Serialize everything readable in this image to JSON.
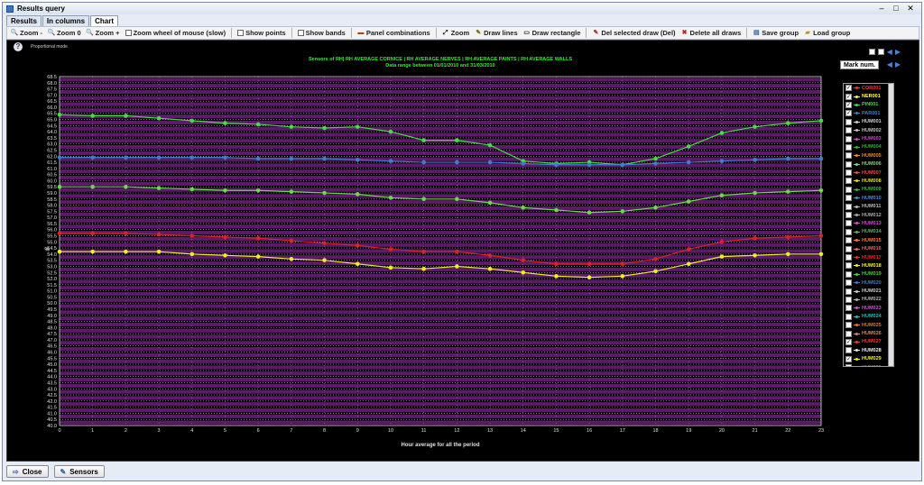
{
  "window": {
    "title": "Results query",
    "controls": {
      "minimize": "–",
      "maximize": "□",
      "close": "✕"
    }
  },
  "tabs": [
    {
      "label": "Results",
      "active": false
    },
    {
      "label": "In columns",
      "active": false
    },
    {
      "label": "Chart",
      "active": true
    }
  ],
  "toolbar": {
    "zoom_out": "Zoom -",
    "zoom_zero": "Zoom 0",
    "zoom_in": "Zoom +",
    "zoom_wheel": "Zoom wheel of mouse (slow)",
    "show_points": "Show points",
    "show_bands": "Show bands",
    "panel_combinations": "Panel combinations",
    "zoom": "Zoom",
    "draw_lines": "Draw lines",
    "draw_rectangle": "Draw rectangle",
    "del_selected": "Del selected draw (Del)",
    "delete_all": "Delete all draws",
    "save_group": "Save group",
    "load_group": "Load group"
  },
  "chart_header": {
    "help": "?",
    "mode": "Proportional mode",
    "mark_num": "Mark num."
  },
  "chart_data": {
    "type": "line",
    "title": "Sensors of RH| RH AVERAGE CORNICE | RH AVERAGE NERVES | RH AVERAGE PAINTS | RH AVERAGE WALLS",
    "subtitle": "Data range between 01/01/2010 and 31/03/2010",
    "xlabel": "Hour average for all the period",
    "ylabel": "%",
    "x": [
      0,
      1,
      2,
      3,
      4,
      5,
      6,
      7,
      8,
      9,
      10,
      11,
      12,
      13,
      14,
      15,
      16,
      17,
      18,
      19,
      20,
      21,
      22,
      23
    ],
    "xlim": [
      0,
      23
    ],
    "ylim": [
      40,
      68.5
    ],
    "yticks": [
      40.0,
      40.5,
      41.0,
      41.5,
      42.0,
      42.5,
      43.0,
      43.5,
      44.0,
      44.5,
      45.0,
      45.5,
      46.0,
      46.5,
      47.0,
      47.5,
      48.0,
      48.5,
      49.0,
      49.5,
      50.0,
      50.5,
      51.0,
      51.5,
      52.0,
      52.5,
      53.0,
      53.5,
      54.0,
      54.5,
      55.0,
      55.5,
      56.0,
      56.5,
      57.0,
      57.5,
      58.0,
      58.5,
      59.0,
      59.5,
      60.0,
      60.5,
      61.0,
      61.5,
      62.0,
      62.5,
      63.0,
      63.5,
      64.0,
      64.5,
      65.0,
      65.5,
      66.0,
      66.5,
      67.0,
      67.5,
      68.0,
      68.5
    ],
    "bands": true,
    "series": [
      {
        "name": "COR001",
        "color": "#44dd44",
        "values": [
          65.4,
          65.3,
          65.3,
          65.1,
          64.9,
          64.7,
          64.6,
          64.4,
          64.3,
          64.4,
          64.0,
          63.3,
          63.3,
          62.9,
          61.6,
          61.4,
          61.5,
          61.3,
          61.8,
          62.8,
          63.9,
          64.4,
          64.7,
          64.9
        ]
      },
      {
        "name": "PAR001",
        "color": "#3a7fd0",
        "values": [
          61.9,
          61.9,
          61.9,
          61.9,
          61.9,
          61.9,
          61.8,
          61.8,
          61.8,
          61.7,
          61.6,
          61.5,
          61.5,
          61.5,
          61.4,
          61.3,
          61.3,
          61.3,
          61.4,
          61.5,
          61.6,
          61.7,
          61.8,
          61.8
        ]
      },
      {
        "name": "NER001",
        "color": "#66dd44",
        "values": [
          59.5,
          59.5,
          59.5,
          59.4,
          59.3,
          59.2,
          59.2,
          59.1,
          59.0,
          58.9,
          58.6,
          58.5,
          58.5,
          58.2,
          57.8,
          57.6,
          57.4,
          57.5,
          57.8,
          58.3,
          58.8,
          59.0,
          59.1,
          59.2
        ]
      },
      {
        "name": "HUM027",
        "color": "#dd2222",
        "values": [
          55.7,
          55.7,
          55.7,
          55.6,
          55.5,
          55.4,
          55.3,
          55.1,
          54.9,
          54.7,
          54.4,
          54.2,
          54.2,
          53.9,
          53.5,
          53.2,
          53.2,
          53.2,
          53.6,
          54.4,
          55.0,
          55.3,
          55.4,
          55.5
        ]
      },
      {
        "name": "HUM029",
        "color": "#eeee22",
        "values": [
          54.2,
          54.2,
          54.2,
          54.2,
          54.0,
          53.9,
          53.8,
          53.6,
          53.5,
          53.2,
          52.9,
          52.8,
          53.0,
          52.8,
          52.5,
          52.2,
          52.1,
          52.2,
          52.6,
          53.2,
          53.8,
          53.9,
          54.0,
          54.0
        ]
      }
    ]
  },
  "legend": [
    {
      "name": "COR001",
      "color": "#ff3333",
      "checked": true
    },
    {
      "name": "NER001",
      "color": "#ffff44",
      "checked": true
    },
    {
      "name": "PIN001",
      "color": "#44dd44",
      "checked": true
    },
    {
      "name": "PAR001",
      "color": "#3a7fd0",
      "checked": true
    },
    {
      "name": "HUM001",
      "color": "#d0d0d0",
      "checked": false
    },
    {
      "name": "HUM002",
      "color": "#c0c0c0",
      "checked": false
    },
    {
      "name": "HUM003",
      "color": "#cc44cc",
      "checked": false
    },
    {
      "name": "HUM004",
      "color": "#33aa33",
      "checked": false
    },
    {
      "name": "HUM005",
      "color": "#ee8833",
      "checked": false
    },
    {
      "name": "HUM006",
      "color": "#88cc88",
      "checked": false
    },
    {
      "name": "HUM007",
      "color": "#ff4444",
      "checked": false
    },
    {
      "name": "HUM008",
      "color": "#dddd33",
      "checked": false
    },
    {
      "name": "HUM009",
      "color": "#33bb33",
      "checked": false
    },
    {
      "name": "HUM010",
      "color": "#4488dd",
      "checked": false
    },
    {
      "name": "HUM011",
      "color": "#bbbbbb",
      "checked": false
    },
    {
      "name": "HUM012",
      "color": "#aaaaaa",
      "checked": false
    },
    {
      "name": "HUM013",
      "color": "#dd44dd",
      "checked": false
    },
    {
      "name": "HUM014",
      "color": "#66aa66",
      "checked": false
    },
    {
      "name": "HUM015",
      "color": "#ff7733",
      "checked": false
    },
    {
      "name": "HUM016",
      "color": "#dd6666",
      "checked": false
    },
    {
      "name": "HUM017",
      "color": "#ff2222",
      "checked": false
    },
    {
      "name": "HUM018",
      "color": "#eeee44",
      "checked": false
    },
    {
      "name": "HUM019",
      "color": "#44cc44",
      "checked": false
    },
    {
      "name": "HUM020",
      "color": "#4477cc",
      "checked": false
    },
    {
      "name": "HUM021",
      "color": "#cccccc",
      "checked": false
    },
    {
      "name": "HUM022",
      "color": "#b0b0b0",
      "checked": false
    },
    {
      "name": "HUM023",
      "color": "#cc55cc",
      "checked": false
    },
    {
      "name": "HUM024",
      "color": "#22bbbb",
      "checked": false
    },
    {
      "name": "HUM025",
      "color": "#dd7733",
      "checked": false
    },
    {
      "name": "HUM026",
      "color": "#cc8866",
      "checked": false
    },
    {
      "name": "HUM027",
      "color": "#ff3333",
      "checked": true
    },
    {
      "name": "HUM028",
      "color": "#eeeeee",
      "checked": false
    },
    {
      "name": "HUM029",
      "color": "#eeee22",
      "checked": true
    },
    {
      "name": "HUM030",
      "color": "#3377cc",
      "checked": false
    },
    {
      "name": "HUM031",
      "color": "#dd9955",
      "checked": false
    },
    {
      "name": "HUM032",
      "color": "#c8c8c8",
      "checked": false
    }
  ],
  "footer": {
    "close": "Close",
    "sensors": "Sensors"
  }
}
